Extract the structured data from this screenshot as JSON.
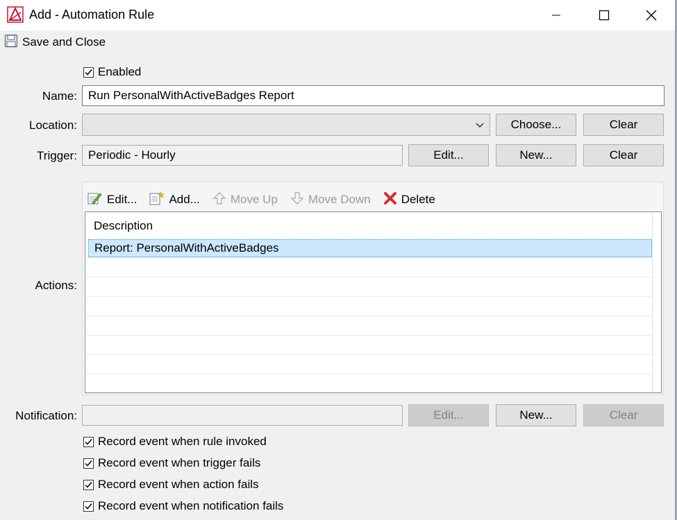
{
  "window": {
    "title": "Add - Automation Rule",
    "minimize_glyph": "—",
    "maximize_glyph": "☐",
    "close_glyph": "✕"
  },
  "toolbar": {
    "save_close_label": "Save and Close"
  },
  "form": {
    "enabled_label": "Enabled",
    "enabled_checked": true,
    "name_label": "Name:",
    "name_value": "Run PersonalWithActiveBadges Report",
    "location_label": "Location:",
    "location_value": "",
    "location_choose": "Choose...",
    "location_clear": "Clear",
    "trigger_label": "Trigger:",
    "trigger_value": "Periodic - Hourly",
    "trigger_edit": "Edit...",
    "trigger_new": "New...",
    "trigger_clear": "Clear",
    "actions_label": "Actions:",
    "notification_label": "Notification:",
    "notification_value": "",
    "notification_edit": "Edit...",
    "notification_new": "New...",
    "notification_clear": "Clear"
  },
  "actions": {
    "toolbar": {
      "edit": "Edit...",
      "add": "Add...",
      "move_up": "Move Up",
      "move_down": "Move Down",
      "delete": "Delete"
    },
    "column_header": "Description",
    "rows": [
      "Report: PersonalWithActiveBadges"
    ]
  },
  "options": [
    {
      "label": "Record event when rule invoked",
      "checked": true
    },
    {
      "label": "Record event when trigger fails",
      "checked": true
    },
    {
      "label": "Record event when action fails",
      "checked": true
    },
    {
      "label": "Record event when notification fails",
      "checked": true
    }
  ],
  "colors": {
    "selection": "#cce8ff",
    "delete_icon": "#e0262b",
    "accent_red": "#c8102e"
  }
}
